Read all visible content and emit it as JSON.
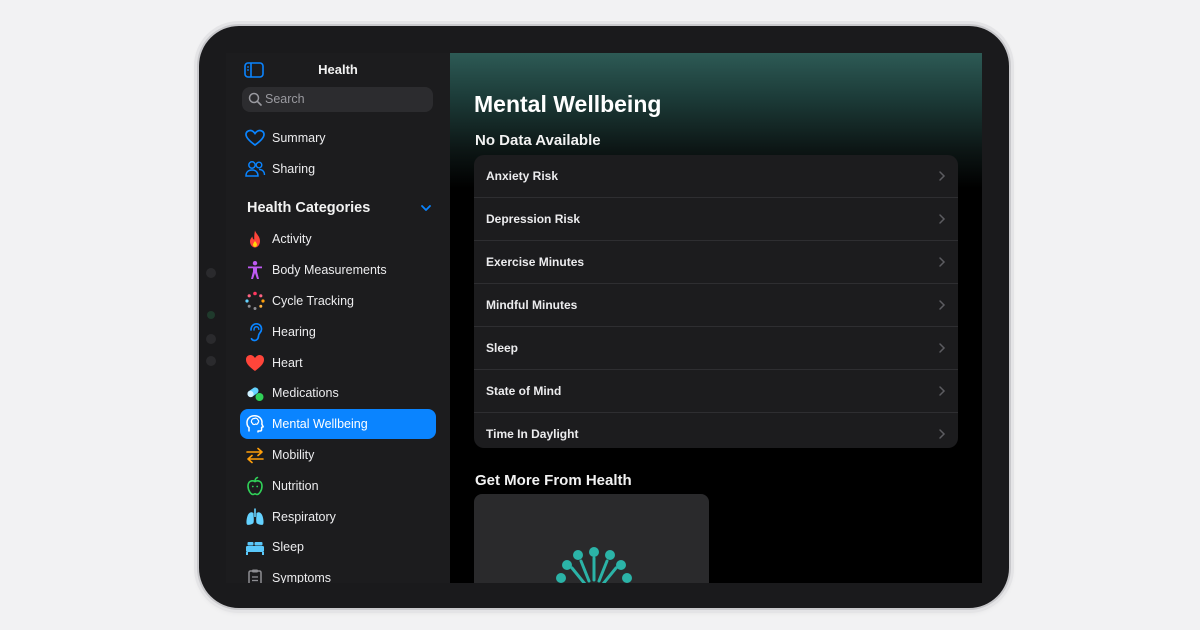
{
  "sidebar": {
    "title": "Health",
    "search_placeholder": "Search",
    "top_items": [
      {
        "label": "Summary",
        "icon": "heart-outline-icon"
      },
      {
        "label": "Sharing",
        "icon": "people-icon"
      }
    ],
    "categories_title": "Health Categories",
    "categories": [
      {
        "label": "Activity",
        "icon": "flame-icon",
        "color": "#ff453a"
      },
      {
        "label": "Body Measurements",
        "icon": "figure-icon",
        "color": "#bf5af2"
      },
      {
        "label": "Cycle Tracking",
        "icon": "cycle-icon",
        "color": "#ff6482"
      },
      {
        "label": "Hearing",
        "icon": "ear-icon",
        "color": "#0a84ff"
      },
      {
        "label": "Heart",
        "icon": "heart-icon",
        "color": "#ff453a"
      },
      {
        "label": "Medications",
        "icon": "pills-icon",
        "color": "#64d2ff"
      },
      {
        "label": "Mental Wellbeing",
        "icon": "head-icon",
        "color": "#ffffff",
        "active": true
      },
      {
        "label": "Mobility",
        "icon": "arrows-icon",
        "color": "#ff9f0a"
      },
      {
        "label": "Nutrition",
        "icon": "apple-icon",
        "color": "#30d158"
      },
      {
        "label": "Respiratory",
        "icon": "lungs-icon",
        "color": "#64d2ff"
      },
      {
        "label": "Sleep",
        "icon": "bed-icon",
        "color": "#5ac8fa"
      },
      {
        "label": "Symptoms",
        "icon": "clipboard-icon",
        "color": "#8e8e93"
      }
    ]
  },
  "main": {
    "title": "Mental Wellbeing",
    "no_data_title": "No Data Available",
    "rows": [
      "Anxiety Risk",
      "Depression Risk",
      "Exercise Minutes",
      "Mindful Minutes",
      "Sleep",
      "State of Mind",
      "Time In Daylight"
    ],
    "more_title": "Get More From Health"
  },
  "colors": {
    "accent": "#0a84ff",
    "header_teal": "#2d5a55",
    "card_illustration": "#2bb3a7"
  }
}
